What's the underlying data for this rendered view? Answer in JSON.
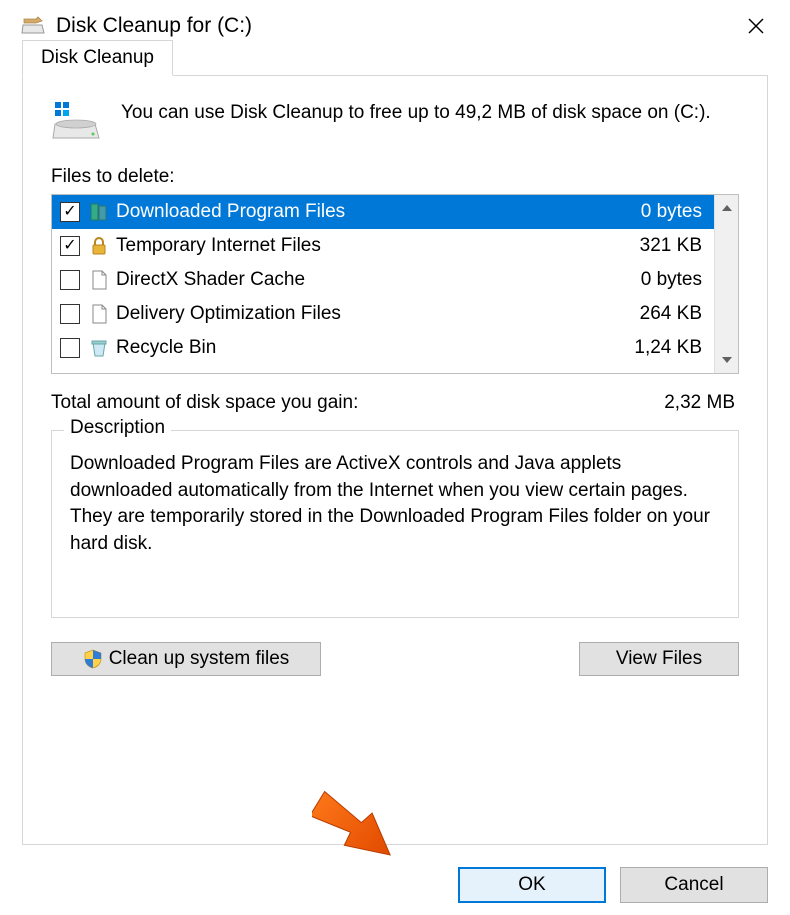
{
  "title": "Disk Cleanup for  (C:)",
  "tab_label": "Disk Cleanup",
  "intro_text": "You can use Disk Cleanup to free up to 49,2 MB of disk space on  (C:).",
  "files_to_delete_label": "Files to delete:",
  "file_items": [
    {
      "name": "Downloaded Program Files",
      "size": "0 bytes",
      "checked": true,
      "selected": true,
      "icon": "program-files-icon"
    },
    {
      "name": "Temporary Internet Files",
      "size": "321 KB",
      "checked": true,
      "selected": false,
      "icon": "lock-icon"
    },
    {
      "name": "DirectX Shader Cache",
      "size": "0 bytes",
      "checked": false,
      "selected": false,
      "icon": "file-icon"
    },
    {
      "name": "Delivery Optimization Files",
      "size": "264 KB",
      "checked": false,
      "selected": false,
      "icon": "file-icon"
    },
    {
      "name": "Recycle Bin",
      "size": "1,24 KB",
      "checked": false,
      "selected": false,
      "icon": "recycle-bin-icon"
    }
  ],
  "total_label": "Total amount of disk space you gain:",
  "total_value": "2,32 MB",
  "description_legend": "Description",
  "description_text": "Downloaded Program Files are ActiveX controls and Java applets downloaded automatically from the Internet when you view certain pages. They are temporarily stored in the Downloaded Program Files folder on your hard disk.",
  "clean_system_label": "Clean up system files",
  "view_files_label": "View Files",
  "ok_label": "OK",
  "cancel_label": "Cancel"
}
